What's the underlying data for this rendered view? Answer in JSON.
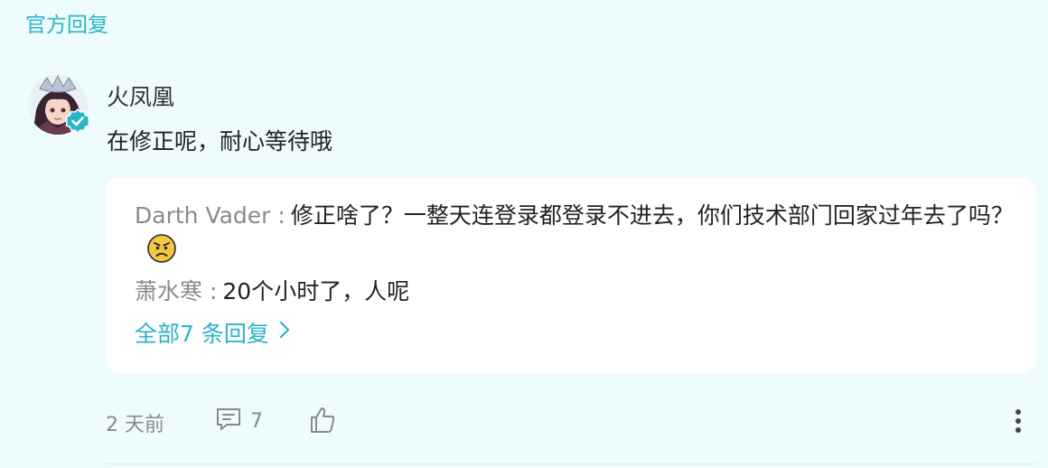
{
  "section": {
    "label": "官方回复"
  },
  "comment": {
    "author": "火凤凰",
    "text": "在修正呢，耐心等待哦",
    "replies": [
      {
        "author": "Darth Vader",
        "separator": ":",
        "text": "修正啥了？一整天连登录都登录不进去，你们技术部门回家过年去了吗？",
        "emoji": "angry-face-emoji"
      },
      {
        "author": "萧水寒",
        "separator": ":",
        "text": "20个小时了，人呢"
      }
    ],
    "all_replies_label": "全部7 条回复",
    "timestamp": "2 天前",
    "comment_count": "7"
  },
  "colors": {
    "background": "#eefcfd",
    "accent": "#2bb4c6",
    "muted": "#8a8a8a",
    "card": "#ffffff"
  },
  "icons": {
    "verified": "check-badge-icon",
    "comment": "speech-bubble-icon",
    "like": "thumbs-up-icon",
    "more": "vertical-ellipsis-icon",
    "chevron": "chevron-right-icon"
  }
}
